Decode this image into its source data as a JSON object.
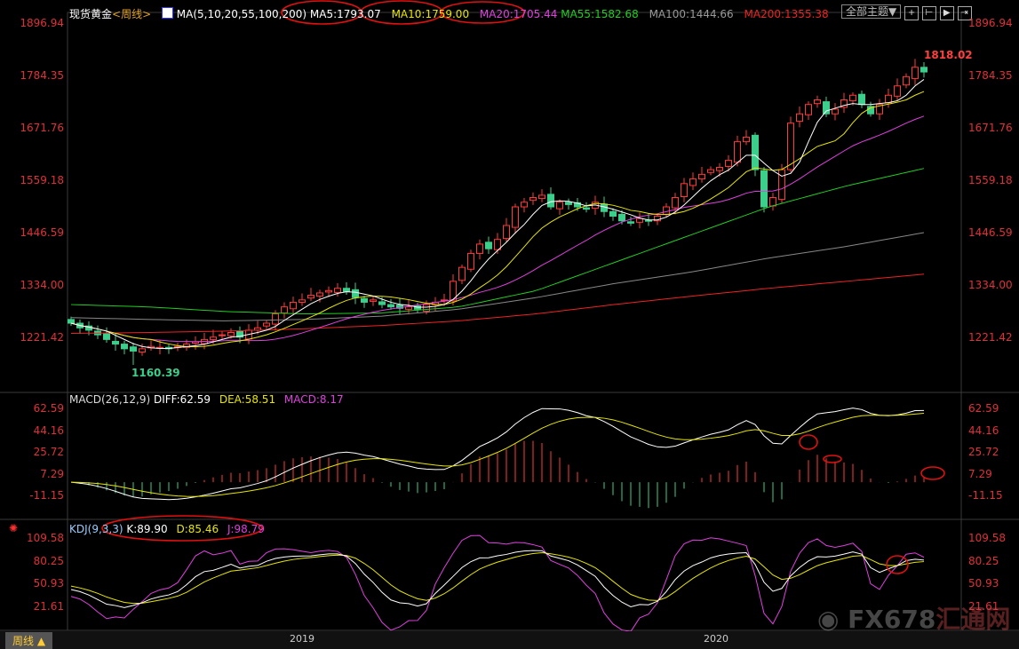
{
  "header": {
    "instrument": "现货黄金",
    "period": "<周线>",
    "ma_label": "MA(5,10,20,55,100,200)",
    "ma5": "MA5:1793.07",
    "ma10": "MA10:1759.00",
    "ma20": "MA20:1705.44",
    "ma55": "MA55:1582.68",
    "ma100": "MA100:1444.66",
    "ma200": "MA200:1355.38",
    "theme_button": "全部主题▼"
  },
  "macd_header": {
    "label": "MACD(26,12,9)",
    "diff": "DIFF:62.59",
    "dea": "DEA:58.51",
    "macd": "MACD:8.17"
  },
  "kdj_header": {
    "label": "KDJ(9,3,3)",
    "k": "K:89.90",
    "d": "D:85.46",
    "j": "J:98.79"
  },
  "price_axis": [
    "1896.94",
    "1784.35",
    "1671.76",
    "1559.18",
    "1446.59",
    "1334.00",
    "1221.42"
  ],
  "macd_axis": [
    "62.59",
    "44.16",
    "25.72",
    "7.29",
    "-11.15"
  ],
  "kdj_axis": [
    "109.58",
    "80.25",
    "50.93",
    "21.61"
  ],
  "annotations": {
    "high": "1818.02",
    "low": "1160.39"
  },
  "footer": {
    "period_button": "周线 ▲",
    "dates": [
      "2019",
      "2020"
    ],
    "watermark": "FX678汇通网"
  },
  "colors": {
    "up": "#ff3b3b",
    "down": "#3ccf8c",
    "ma5": "#ffffff",
    "ma10": "#e6e600",
    "ma20": "#e040e0",
    "ma55": "#22cc22",
    "ma100": "#888888",
    "ma200": "#ee2222"
  },
  "chart_data": {
    "type": "candlestick",
    "title": "现货黄金 周线",
    "ylim": [
      1160,
      1900
    ],
    "closes": [
      1250,
      1240,
      1235,
      1225,
      1215,
      1205,
      1195,
      1190,
      1195,
      1200,
      1198,
      1195,
      1200,
      1205,
      1210,
      1215,
      1220,
      1225,
      1230,
      1220,
      1235,
      1240,
      1250,
      1270,
      1285,
      1295,
      1300,
      1310,
      1315,
      1320,
      1325,
      1318,
      1305,
      1295,
      1300,
      1290,
      1285,
      1282,
      1285,
      1280,
      1290,
      1295,
      1300,
      1340,
      1370,
      1400,
      1420,
      1410,
      1430,
      1460,
      1500,
      1510,
      1520,
      1525,
      1500,
      1510,
      1505,
      1500,
      1495,
      1510,
      1490,
      1480,
      1470,
      1465,
      1475,
      1470,
      1480,
      1500,
      1520,
      1550,
      1560,
      1570,
      1580,
      1585,
      1600,
      1640,
      1650,
      1580,
      1500,
      1520,
      1580,
      1680,
      1700,
      1720,
      1730,
      1700,
      1710,
      1730,
      1740,
      1720,
      1700,
      1720,
      1740,
      1760,
      1780,
      1800,
      1790
    ],
    "ma55": [
      1290,
      1285,
      1275,
      1270,
      1272,
      1285,
      1320,
      1380,
      1440,
      1500,
      1545,
      1582.68
    ],
    "ma100": [
      1262,
      1258,
      1255,
      1258,
      1265,
      1280,
      1305,
      1335,
      1360,
      1390,
      1415,
      1444.66
    ],
    "ma200": [
      1228,
      1230,
      1233,
      1238,
      1245,
      1255,
      1270,
      1290,
      1308,
      1325,
      1340,
      1355.38
    ],
    "x_ticks": [
      "2019",
      "2020"
    ]
  }
}
